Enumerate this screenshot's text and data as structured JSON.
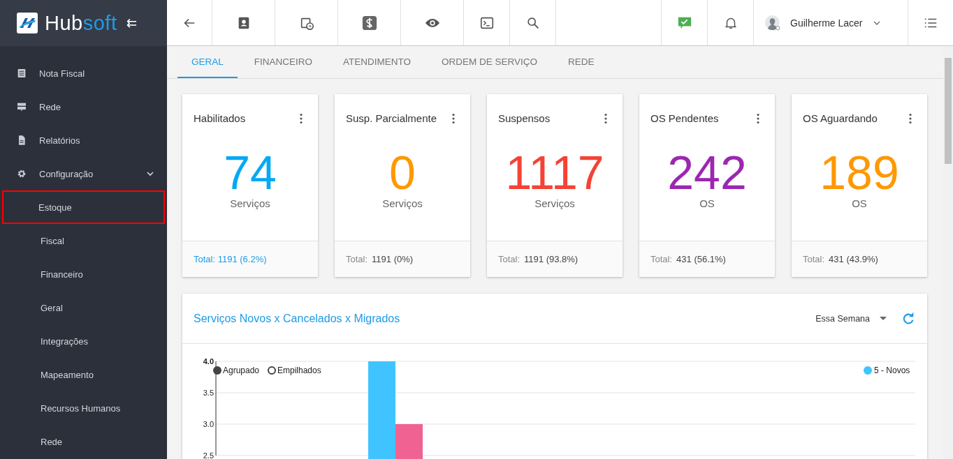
{
  "sidebar": {
    "logo": {
      "brand_part1": "Hub",
      "brand_part2": "soft",
      "collapse": "⇇"
    },
    "items": [
      {
        "label": "Nota Fiscal"
      },
      {
        "label": "Rede"
      },
      {
        "label": "Relatórios"
      },
      {
        "label": "Configuração",
        "expanded": true,
        "children": [
          {
            "label": "Estoque",
            "selected": true
          },
          {
            "label": "Fiscal",
            "selected": false
          },
          {
            "label": "Financeiro",
            "selected": false
          },
          {
            "label": "Geral",
            "selected": false
          },
          {
            "label": "Integrações",
            "selected": false
          },
          {
            "label": "Mapeamento",
            "selected": false
          },
          {
            "label": "Recursos Humanos",
            "selected": false
          },
          {
            "label": "Rede",
            "selected": false
          }
        ]
      }
    ]
  },
  "topbar": {
    "user": {
      "name": "Guilherme Lacer"
    }
  },
  "tabs": [
    {
      "label": "GERAL",
      "selected": true
    },
    {
      "label": "FINANCEIRO",
      "selected": false
    },
    {
      "label": "ATENDIMENTO",
      "selected": false
    },
    {
      "label": "ORDEM DE SERVIÇO",
      "selected": false
    },
    {
      "label": "REDE",
      "selected": false
    }
  ],
  "cards": [
    {
      "title": "Habilitados",
      "value": "74",
      "unit": "Serviços",
      "color": "#03a9f4",
      "total_label": "Total:",
      "total_value": "1191 (6.2%)",
      "footer_link": true
    },
    {
      "title": "Susp. Parcialmente",
      "value": "0",
      "unit": "Serviços",
      "color": "#ff9800",
      "total_label": "Total:",
      "total_value": "1191 (0%)",
      "footer_link": false
    },
    {
      "title": "Suspensos",
      "value": "1117",
      "unit": "Serviços",
      "color": "#f44336",
      "total_label": "Total:",
      "total_value": "1191 (93.8%)",
      "footer_link": false
    },
    {
      "title": "OS Pendentes",
      "value": "242",
      "unit": "OS",
      "color": "#9c27b0",
      "total_label": "Total:",
      "total_value": "431 (56.1%)",
      "footer_link": false
    },
    {
      "title": "OS Aguardando",
      "value": "189",
      "unit": "OS",
      "color": "#ff9800",
      "total_label": "Total:",
      "total_value": "431 (43.9%)",
      "footer_link": false
    }
  ],
  "chart_panel": {
    "title": "Serviços Novos x Cancelados x Migrados",
    "period": "Essa Semana",
    "modes": [
      {
        "label": "Agrupado",
        "selected": true
      },
      {
        "label": "Empilhados",
        "selected": false
      }
    ],
    "chart_data": {
      "type": "bar",
      "ylim": [
        2.5,
        4
      ],
      "yticks": [
        {
          "value": 2.5,
          "label": "2.5"
        },
        {
          "value": 3,
          "label": "3.0"
        },
        {
          "value": 3.5,
          "label": "3.5"
        },
        {
          "value": 4,
          "label": "4.0"
        }
      ],
      "series": [
        {
          "name": "5 - Novos",
          "color": "#40c4ff",
          "values": [
            4
          ]
        },
        {
          "color": "#f06292",
          "values": [
            3
          ]
        }
      ]
    }
  }
}
